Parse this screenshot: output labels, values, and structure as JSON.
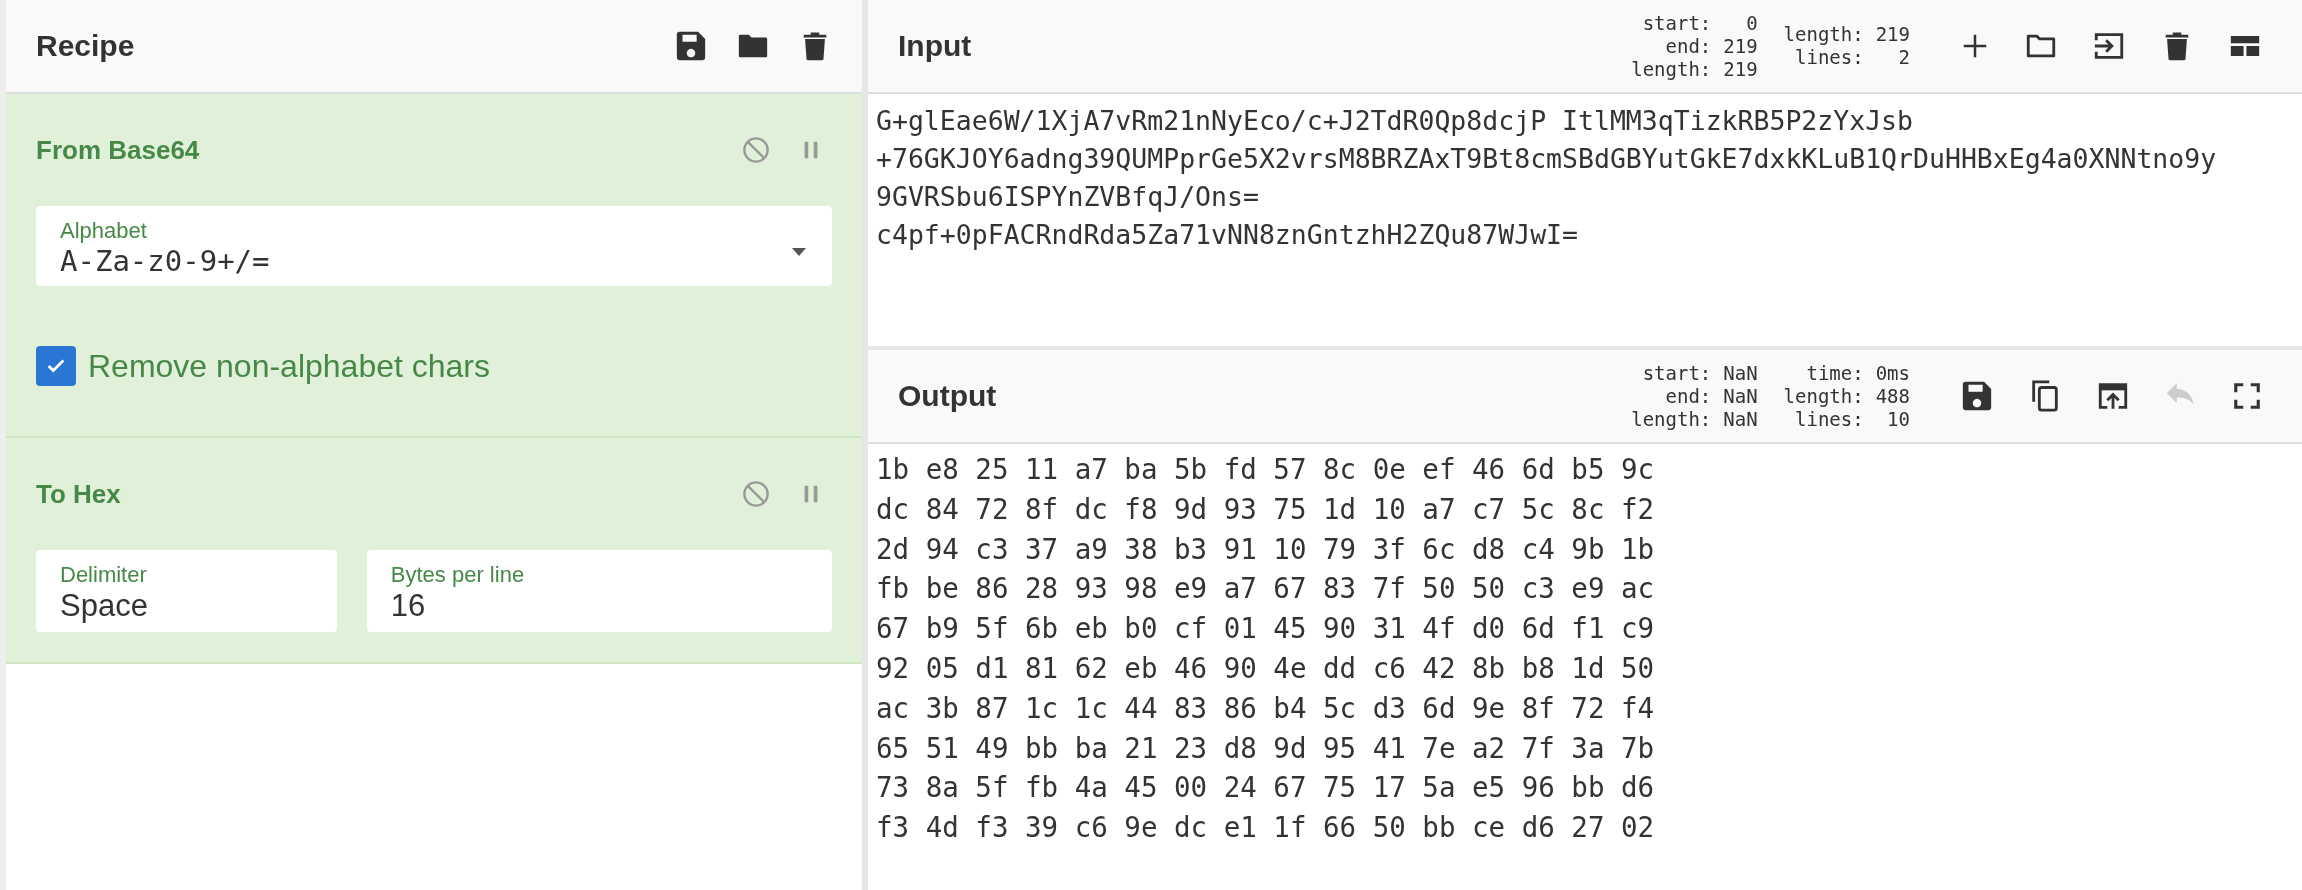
{
  "recipe": {
    "title": "Recipe",
    "operations": [
      {
        "title": "From Base64",
        "args": [
          {
            "kind": "dropdown",
            "label": "Alphabet",
            "value": "A-Za-z0-9+/="
          },
          {
            "kind": "checkbox",
            "label": "Remove non-alphabet chars",
            "checked": true
          }
        ]
      },
      {
        "title": "To Hex",
        "args": [
          {
            "kind": "text",
            "label": "Delimiter",
            "value": "Space"
          },
          {
            "kind": "text",
            "label": "Bytes per line",
            "value": "16"
          }
        ]
      }
    ]
  },
  "input": {
    "title": "Input",
    "stats": [
      [
        {
          "label": "start:",
          "value": "0"
        },
        {
          "label": "end:",
          "value": "219"
        },
        {
          "label": "length:",
          "value": "219"
        }
      ],
      [
        {
          "label": "length:",
          "value": "219"
        },
        {
          "label": "lines:",
          "value": "2"
        }
      ]
    ],
    "lines": [
      "G+glEae6W/1XjA7vRm21nNyEco/c+J2TdR0Qp8dcjP ItlMM3qTizkRB5P2zYxJsb",
      "+76GKJOY6adng39QUMPprGe5X2vrsM8BRZAxT9Bt8cmSBdGBYutGkE7dxkKLuB1QrDuHHBxEg4a0XNNtno9y",
      "9GVRSbu6ISPYnZVBfqJ/Ons=",
      "c4pf+0pFACRndRda5Za71vNN8znGntzhH2ZQu87WJwI="
    ]
  },
  "output": {
    "title": "Output",
    "stats": [
      [
        {
          "label": "start:",
          "value": "NaN"
        },
        {
          "label": "end:",
          "value": "NaN"
        },
        {
          "label": "length:",
          "value": "NaN"
        }
      ],
      [
        {
          "label": "time:",
          "value": "0ms"
        },
        {
          "label": "length:",
          "value": "488"
        },
        {
          "label": "lines:",
          "value": "10"
        }
      ]
    ],
    "lines": [
      "1b e8 25 11 a7 ba 5b fd 57 8c 0e ef 46 6d b5 9c",
      "dc 84 72 8f dc f8 9d 93 75 1d 10 a7 c7 5c 8c f2",
      "2d 94 c3 37 a9 38 b3 91 10 79 3f 6c d8 c4 9b 1b",
      "fb be 86 28 93 98 e9 a7 67 83 7f 50 50 c3 e9 ac",
      "67 b9 5f 6b eb b0 cf 01 45 90 31 4f d0 6d f1 c9",
      "92 05 d1 81 62 eb 46 90 4e dd c6 42 8b b8 1d 50",
      "ac 3b 87 1c 1c 44 83 86 b4 5c d3 6d 9e 8f 72 f4",
      "65 51 49 bb ba 21 23 d8 9d 95 41 7e a2 7f 3a 7b",
      "73 8a 5f fb 4a 45 00 24 67 75 17 5a e5 96 bb d6",
      "f3 4d f3 39 c6 9e dc e1 1f 66 50 bb ce d6 27 02"
    ]
  }
}
